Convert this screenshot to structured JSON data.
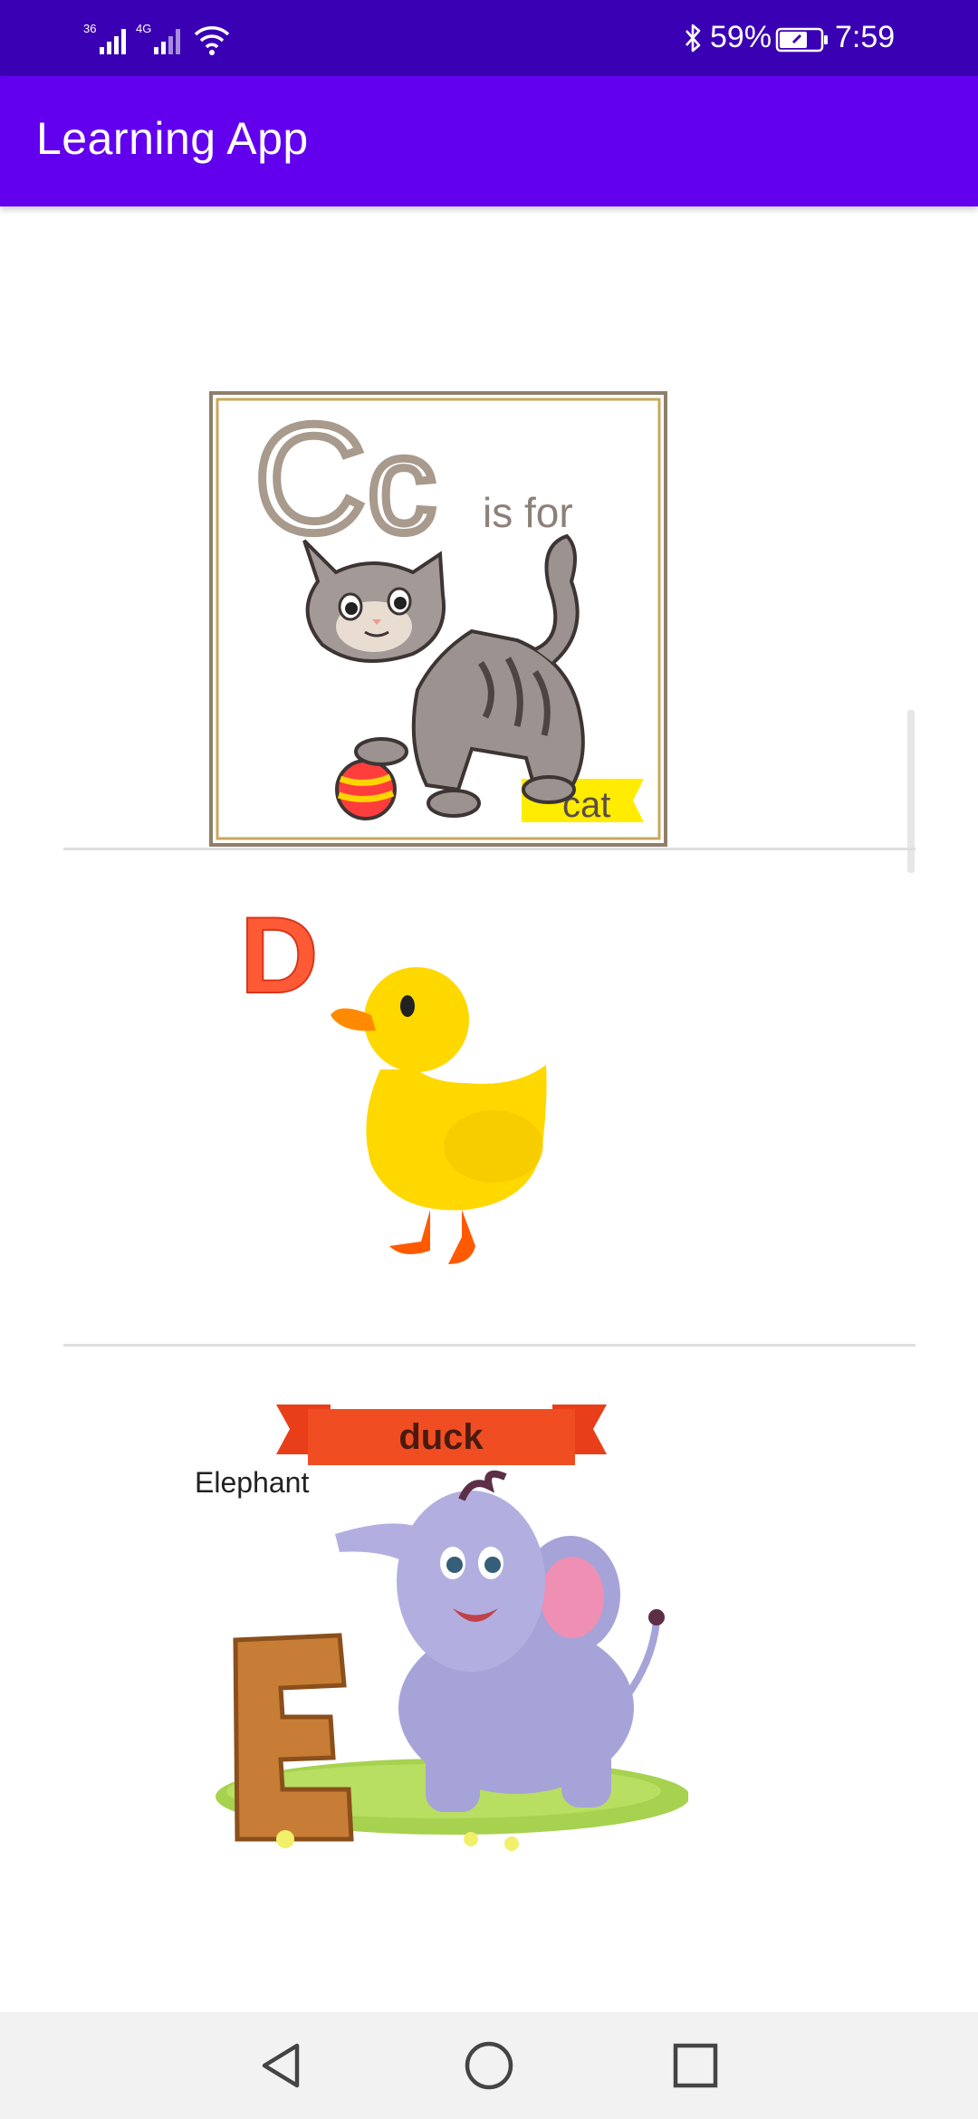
{
  "status_bar": {
    "signal_1_label": "36",
    "signal_2_label": "4G",
    "battery_percent": "59%",
    "time": "7:59"
  },
  "app_bar": {
    "title": "Learning App"
  },
  "items": [
    {
      "letter_upper": "C",
      "letter_lower": "c",
      "caption": "is for",
      "word": "cat"
    },
    {
      "letter": "D",
      "word": "duck"
    },
    {
      "word": "Elephant",
      "letter": "E"
    }
  ]
}
